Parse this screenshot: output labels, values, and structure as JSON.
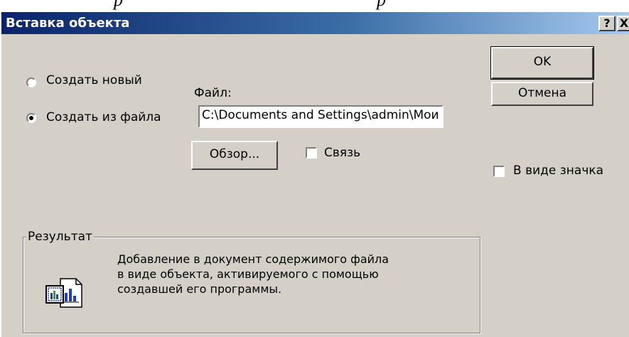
{
  "top_fragment": {
    "left_text": "р",
    "right_text": "р"
  },
  "window": {
    "title": "Вставка объекта",
    "help_label": "?",
    "close_label": "X"
  },
  "options": {
    "create_new_label": "Создать новый",
    "create_from_file_label": "Создать из файла",
    "selected": "create_from_file"
  },
  "file": {
    "label": "Файл:",
    "value": "C:\\Documents and Settings\\admin\\Мои"
  },
  "buttons": {
    "browse_label": "Обзор...",
    "ok_label": "OK",
    "cancel_label": "Отмена"
  },
  "checkboxes": {
    "link_label": "Связь",
    "link_checked": false,
    "as_icon_label": "В виде значка",
    "as_icon_checked": false
  },
  "result": {
    "label": "Результат",
    "lines": [
      "Добавление в документ содержимого файла",
      "в виде объекта, активируемого с помощью",
      "создавшей его программы."
    ]
  },
  "colors": {
    "dialog_bg": "#d4d0c8",
    "title_start": "#0a246a",
    "title_end": "#a6caf0"
  },
  "icons": {
    "result_icon": "embedded-document-icon"
  }
}
